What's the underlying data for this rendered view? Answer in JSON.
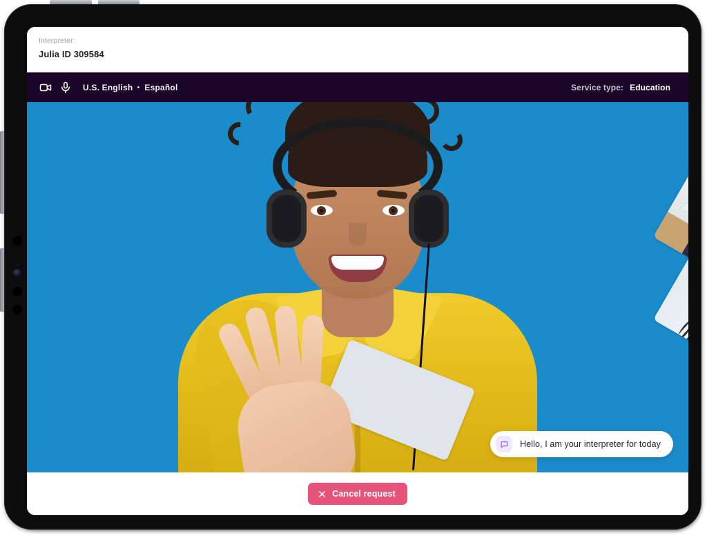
{
  "header": {
    "label": "Interpreter:",
    "value": "Julia ID 309584"
  },
  "toolbar": {
    "video_icon": "video-camera-icon",
    "mic_icon": "microphone-icon",
    "language_from": "U.S. English",
    "language_separator": "•",
    "language_to": "Español",
    "service_type_label": "Service type:",
    "service_type_value": "Education",
    "background_color": "#1b0528"
  },
  "stage": {
    "background_color": "#1a8ccb",
    "main_participant": "interpreter-waving-headphones",
    "thumbnails": [
      {
        "name": "participant-thumbnail-man-waving"
      },
      {
        "name": "participant-thumbnail-woman-smiling"
      }
    ]
  },
  "chat": {
    "icon": "speech-bubble-icon",
    "message": "Hello, I am your interpreter for today",
    "icon_color": "#8b5cf6",
    "icon_bg_color": "#f0e8fb"
  },
  "bottom": {
    "cancel_icon": "close-x-icon",
    "cancel_label": "Cancel request",
    "cancel_color": "#e65579"
  }
}
